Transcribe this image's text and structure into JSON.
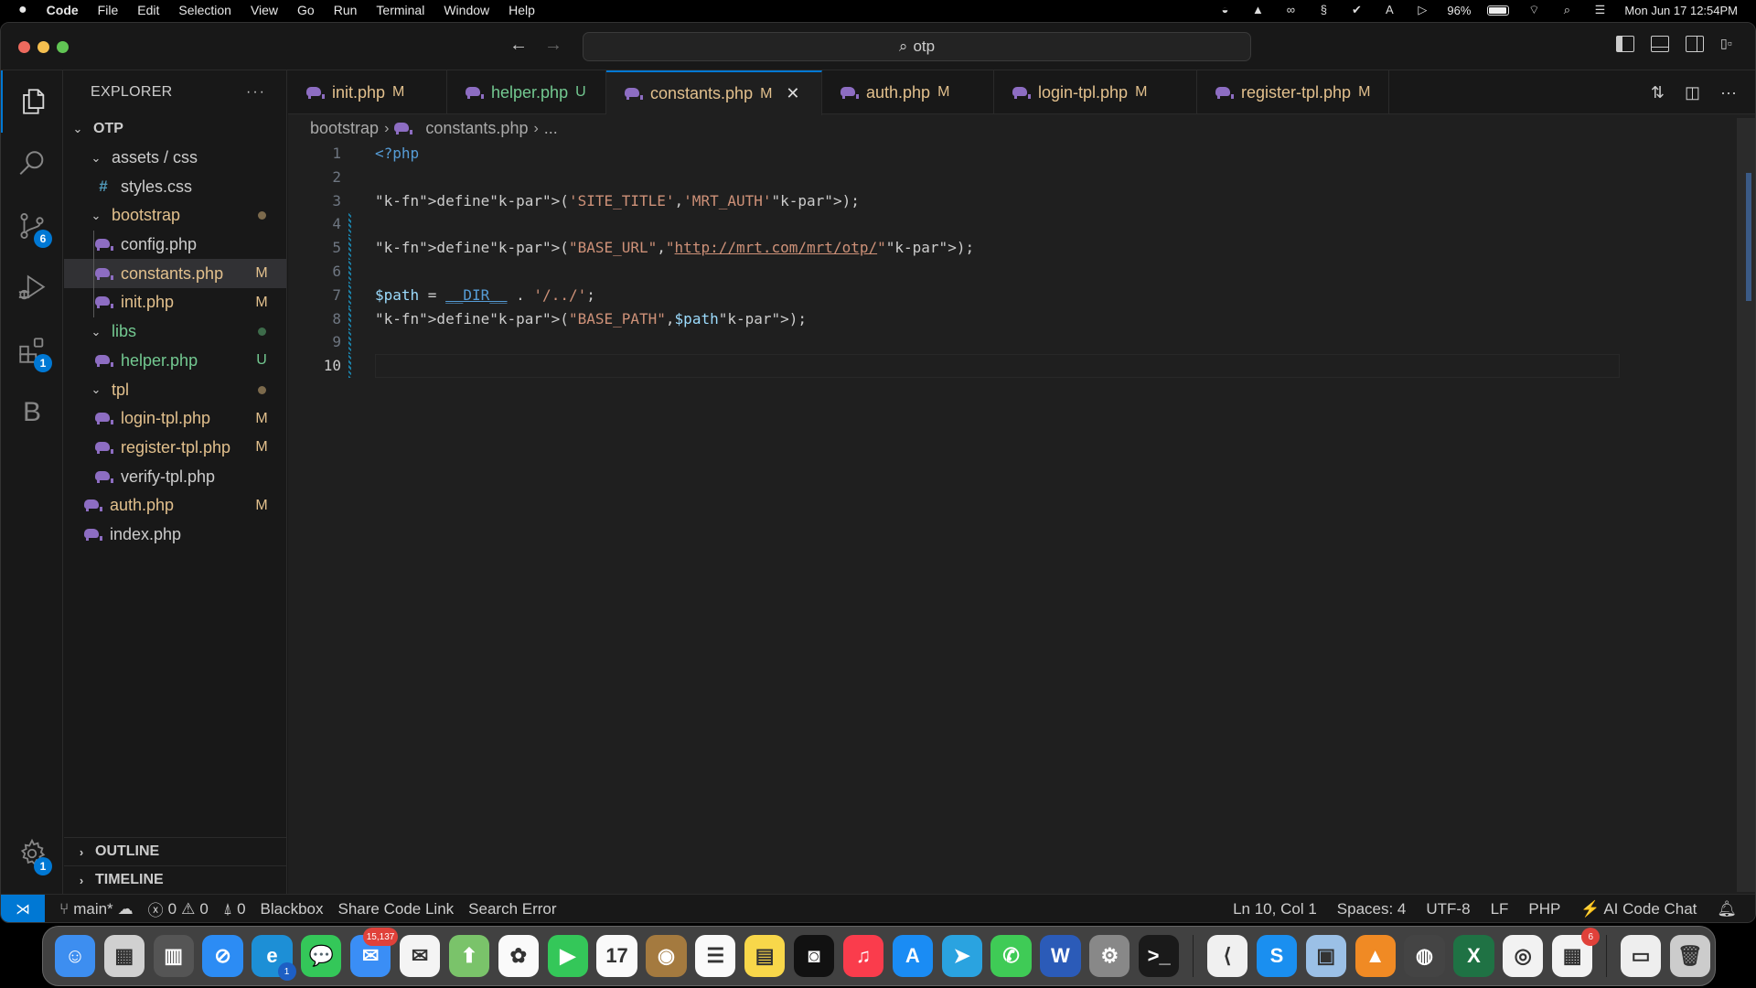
{
  "menubar": {
    "apple": "",
    "app": "Code",
    "menus": [
      "File",
      "Edit",
      "Selection",
      "View",
      "Go",
      "Run",
      "Terminal",
      "Window",
      "Help"
    ],
    "battery": "96%",
    "datetime": "Mon Jun 17  12:54PM"
  },
  "titlebar": {
    "search": "otp",
    "back_icon": "←",
    "forward_icon": "→"
  },
  "activitybar": {
    "scm_badge": "6",
    "extensions_badge": "1",
    "settings_badge": "1",
    "blackbox_letter": "B"
  },
  "sidebar": {
    "title": "EXPLORER",
    "more": "···",
    "root": "OTP",
    "items": [
      {
        "label": "assets / css",
        "type": "folder",
        "status": "",
        "color": "norm",
        "depth": 1
      },
      {
        "label": "styles.css",
        "type": "css",
        "status": "",
        "color": "norm",
        "depth": 2
      },
      {
        "label": "bootstrap",
        "type": "folder",
        "status": "dot-mod",
        "color": "mod",
        "depth": 1
      },
      {
        "label": "config.php",
        "type": "php",
        "status": "",
        "color": "norm",
        "depth": 2
      },
      {
        "label": "constants.php",
        "type": "php",
        "status": "M",
        "color": "mod",
        "depth": 2,
        "selected": true
      },
      {
        "label": "init.php",
        "type": "php",
        "status": "M",
        "color": "mod",
        "depth": 2
      },
      {
        "label": "libs",
        "type": "folder",
        "status": "dot-new",
        "color": "new",
        "depth": 1
      },
      {
        "label": "helper.php",
        "type": "php",
        "status": "U",
        "color": "new",
        "depth": 2
      },
      {
        "label": "tpl",
        "type": "folder",
        "status": "dot-mod",
        "color": "mod",
        "depth": 1
      },
      {
        "label": "login-tpl.php",
        "type": "php",
        "status": "M",
        "color": "mod",
        "depth": 2
      },
      {
        "label": "register-tpl.php",
        "type": "php",
        "status": "M",
        "color": "mod",
        "depth": 2
      },
      {
        "label": "verify-tpl.php",
        "type": "php",
        "status": "",
        "color": "norm",
        "depth": 2
      },
      {
        "label": "auth.php",
        "type": "php",
        "status": "M",
        "color": "mod",
        "depth": 1
      },
      {
        "label": "index.php",
        "type": "php",
        "status": "",
        "color": "norm",
        "depth": 1
      }
    ],
    "outline": "OUTLINE",
    "timeline": "TIMELINE"
  },
  "tabs": [
    {
      "label": "init.php",
      "status": "M",
      "color": "mod",
      "active": false
    },
    {
      "label": "helper.php",
      "status": "U",
      "color": "new",
      "active": false
    },
    {
      "label": "constants.php",
      "status": "M",
      "color": "mod",
      "active": true
    },
    {
      "label": "auth.php",
      "status": "M",
      "color": "mod",
      "active": false
    },
    {
      "label": "login-tpl.php",
      "status": "M",
      "color": "mod",
      "active": false
    },
    {
      "label": "register-tpl.php",
      "status": "M",
      "color": "mod",
      "active": false
    }
  ],
  "breadcrumb": [
    "bootstrap",
    "constants.php",
    "..."
  ],
  "code": {
    "current_line": 10,
    "lines": [
      "<?php",
      "",
      "define('SITE_TITLE','MRT_AUTH');",
      "",
      "define(\"BASE_URL\",\"http://mrt.com/mrt/otp/\");",
      "",
      "$path = __DIR__ . '/../';",
      "define(\"BASE_PATH\",$path);",
      "",
      ""
    ]
  },
  "statusbar": {
    "branch": "main*",
    "errors": "0",
    "warnings": "0",
    "ports": "0",
    "left_items": [
      "Blackbox",
      "Share Code Link",
      "Search Error"
    ],
    "position": "Ln 10, Col 1",
    "spaces": "Spaces: 4",
    "encoding": "UTF-8",
    "eol": "LF",
    "language": "PHP",
    "ai_chat": "AI Code Chat"
  },
  "dock": {
    "apps": [
      {
        "name": "finder",
        "glyph": "☺",
        "bg": "#3d8ef0"
      },
      {
        "name": "launchpad",
        "glyph": "▦",
        "bg": "#d0d0d0"
      },
      {
        "name": "calculator",
        "glyph": "▥",
        "bg": "#555"
      },
      {
        "name": "safari",
        "glyph": "⊘",
        "bg": "#2c8cf4"
      },
      {
        "name": "edge",
        "glyph": "e",
        "bg": "#1d8fd6",
        "badge": "1"
      },
      {
        "name": "messages",
        "glyph": "💬",
        "bg": "#34c759"
      },
      {
        "name": "mail",
        "glyph": "✉",
        "bg": "#3a8ef6",
        "badge": "15,137"
      },
      {
        "name": "airmail",
        "glyph": "✉",
        "bg": "#f4f4f4"
      },
      {
        "name": "maps",
        "glyph": "⬆",
        "bg": "#7ac36a"
      },
      {
        "name": "photos",
        "glyph": "✿",
        "bg": "#fafafa"
      },
      {
        "name": "facetime",
        "glyph": "▶",
        "bg": "#34c759"
      },
      {
        "name": "calendar",
        "glyph": "17",
        "bg": "#fafafa"
      },
      {
        "name": "contacts",
        "glyph": "◉",
        "bg": "#a47a3f"
      },
      {
        "name": "reminders",
        "glyph": "☰",
        "bg": "#fafafa"
      },
      {
        "name": "notes",
        "glyph": "▤",
        "bg": "#f8d74a"
      },
      {
        "name": "chatbot",
        "glyph": "◙",
        "bg": "#111"
      },
      {
        "name": "music",
        "glyph": "♫",
        "bg": "#fa3c4c"
      },
      {
        "name": "app-store",
        "glyph": "A",
        "bg": "#1a8cf4"
      },
      {
        "name": "telegram",
        "glyph": "➤",
        "bg": "#2aa3e0"
      },
      {
        "name": "whatsapp",
        "glyph": "✆",
        "bg": "#3fcb56"
      },
      {
        "name": "word",
        "glyph": "W",
        "bg": "#2b5bb8"
      },
      {
        "name": "system-settings",
        "glyph": "⚙",
        "bg": "#888"
      },
      {
        "name": "terminal",
        "glyph": ">_",
        "bg": "#1a1a1a"
      },
      {
        "name": "separator"
      },
      {
        "name": "vscode",
        "glyph": "⟨",
        "bg": "#f0f0f0"
      },
      {
        "name": "skype",
        "glyph": "S",
        "bg": "#1a8ff0"
      },
      {
        "name": "preview",
        "glyph": "▣",
        "bg": "#9bc0e6"
      },
      {
        "name": "vlc",
        "glyph": "▲",
        "bg": "#f08a24"
      },
      {
        "name": "pasta-app",
        "glyph": "◍",
        "bg": "#444"
      },
      {
        "name": "excel",
        "glyph": "X",
        "bg": "#1f7244"
      },
      {
        "name": "chrome",
        "glyph": "◎",
        "bg": "#f2f2f2"
      },
      {
        "name": "ms-store",
        "glyph": "▦",
        "bg": "#f2f2f2",
        "badge": "6"
      },
      {
        "name": "separator"
      },
      {
        "name": "installer-disk",
        "glyph": "▭",
        "bg": "#eee"
      },
      {
        "name": "trash",
        "glyph": "🗑",
        "bg": "#ccc"
      }
    ]
  },
  "colors": {
    "accent": "#0078d4",
    "modified": "#e2c08d",
    "untracked": "#73c991",
    "php_icon": "#8d6dc2"
  }
}
